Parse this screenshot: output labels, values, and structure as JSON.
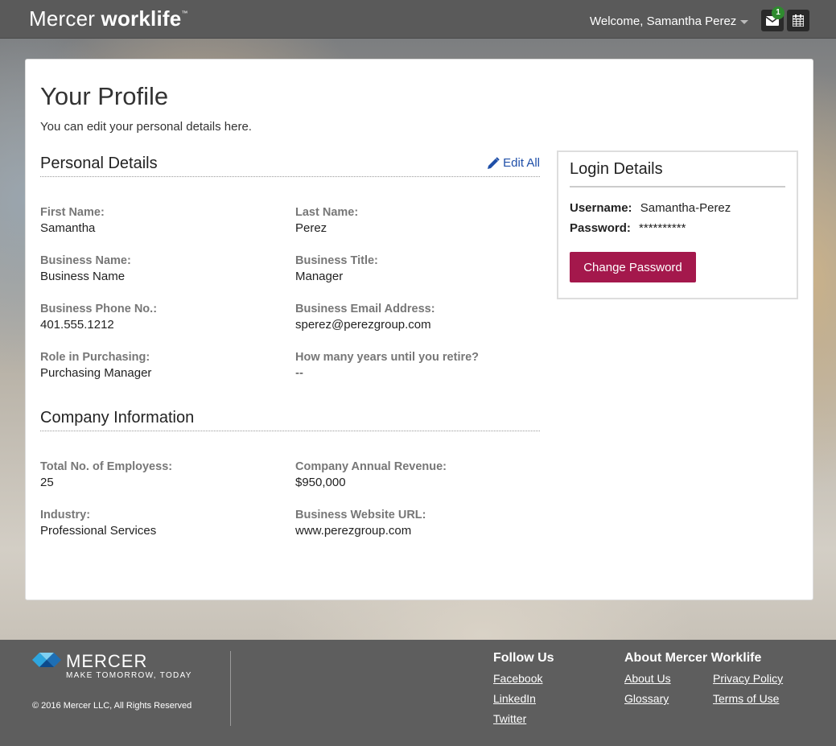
{
  "header": {
    "brand_light": "Mercer",
    "brand_bold": "worklife",
    "brand_tm": "™",
    "welcome": "Welcome, Samantha Perez",
    "mail_badge": "1"
  },
  "profile": {
    "title": "Your Profile",
    "subtitle": "You can edit your personal details here."
  },
  "personal": {
    "title": "Personal Details",
    "edit_all": "Edit All",
    "fields": [
      {
        "label": "First Name:",
        "value": "Samantha"
      },
      {
        "label": "Last Name:",
        "value": "Perez"
      },
      {
        "label": "Business Name:",
        "value": "Business Name"
      },
      {
        "label": "Business Title:",
        "value": "Manager"
      },
      {
        "label": "Business Phone No.:",
        "value": "401.555.1212"
      },
      {
        "label": "Business Email Address:",
        "value": "sperez@perezgroup.com"
      },
      {
        "label": "Role in Purchasing:",
        "value": "Purchasing Manager"
      },
      {
        "label": "How many years until you retire?",
        "value": "--"
      }
    ]
  },
  "company": {
    "title": "Company Information",
    "fields": [
      {
        "label": "Total No. of Employess:",
        "value": "25"
      },
      {
        "label": "Company Annual Revenue:",
        "value": "$950,000"
      },
      {
        "label": "Industry:",
        "value": "Professional Services"
      },
      {
        "label": "Business Website URL:",
        "value": "www.perezgroup.com"
      }
    ]
  },
  "login": {
    "title": "Login Details",
    "username_label": "Username:",
    "username_value": "Samantha-Perez",
    "password_label": "Password:",
    "password_value": "**********",
    "change_button": "Change Password"
  },
  "footer": {
    "logo_wordmark": "MERCER",
    "logo_tagline": "MAKE TOMORROW, TODAY",
    "copyright": "© 2016 Mercer LLC, All Rights Reserved",
    "follow_title": "Follow Us",
    "follow_links": [
      "Facebook",
      "LinkedIn",
      "Twitter"
    ],
    "about_title": "About Mercer Worklife",
    "about_links": [
      "About Us",
      "Privacy Policy",
      "Glossary",
      "Terms of Use"
    ]
  },
  "colors": {
    "header_bg": "#5a5a5a",
    "accent": "#a4184c",
    "link": "#1f4fa8",
    "badge": "#2e8b2e"
  },
  "icons": [
    "envelope-icon",
    "calendar-icon",
    "pencil-icon",
    "caret-down-icon",
    "mercer-logo-icon"
  ]
}
